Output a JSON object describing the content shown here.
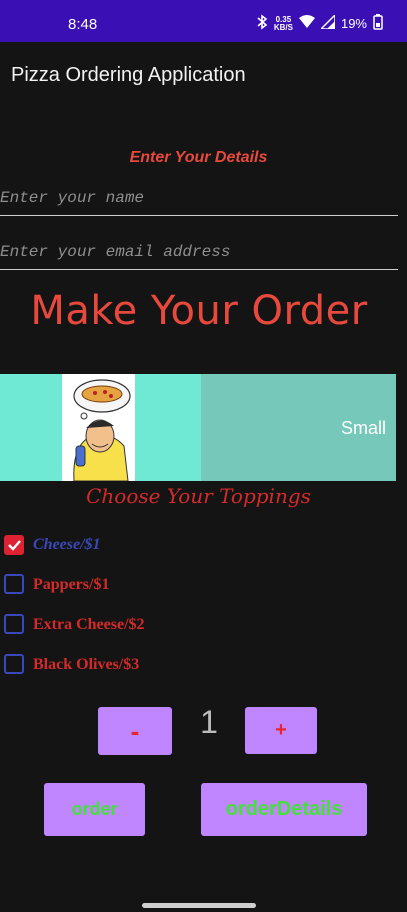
{
  "status": {
    "time": "8:48",
    "netspeed_value": "0.35",
    "netspeed_unit": "KB/S",
    "battery": "19%"
  },
  "appbar": {
    "title": "Pizza Ordering Application"
  },
  "form": {
    "heading": "Enter Your Details",
    "name_placeholder": "Enter your name",
    "email_placeholder": "Enter your email address"
  },
  "order": {
    "title": "Make Your Order",
    "size": "Small"
  },
  "toppings": {
    "title": "Choose Your Toppings",
    "items": [
      {
        "label": "Cheese/$1",
        "checked": true
      },
      {
        "label": "Pappers/$1",
        "checked": false
      },
      {
        "label": "Extra Cheese/$2",
        "checked": false
      },
      {
        "label": "Black Olives/$3",
        "checked": false
      }
    ]
  },
  "quantity": {
    "minus_label": "-",
    "value": "1",
    "plus_label": "+"
  },
  "actions": {
    "order_label": "order",
    "details_label": "orderDetails"
  },
  "colors": {
    "accent": "#e8493d",
    "button": "#bf86ff",
    "button_text_green": "#45e03a",
    "button_text_red": "#e8252f"
  }
}
